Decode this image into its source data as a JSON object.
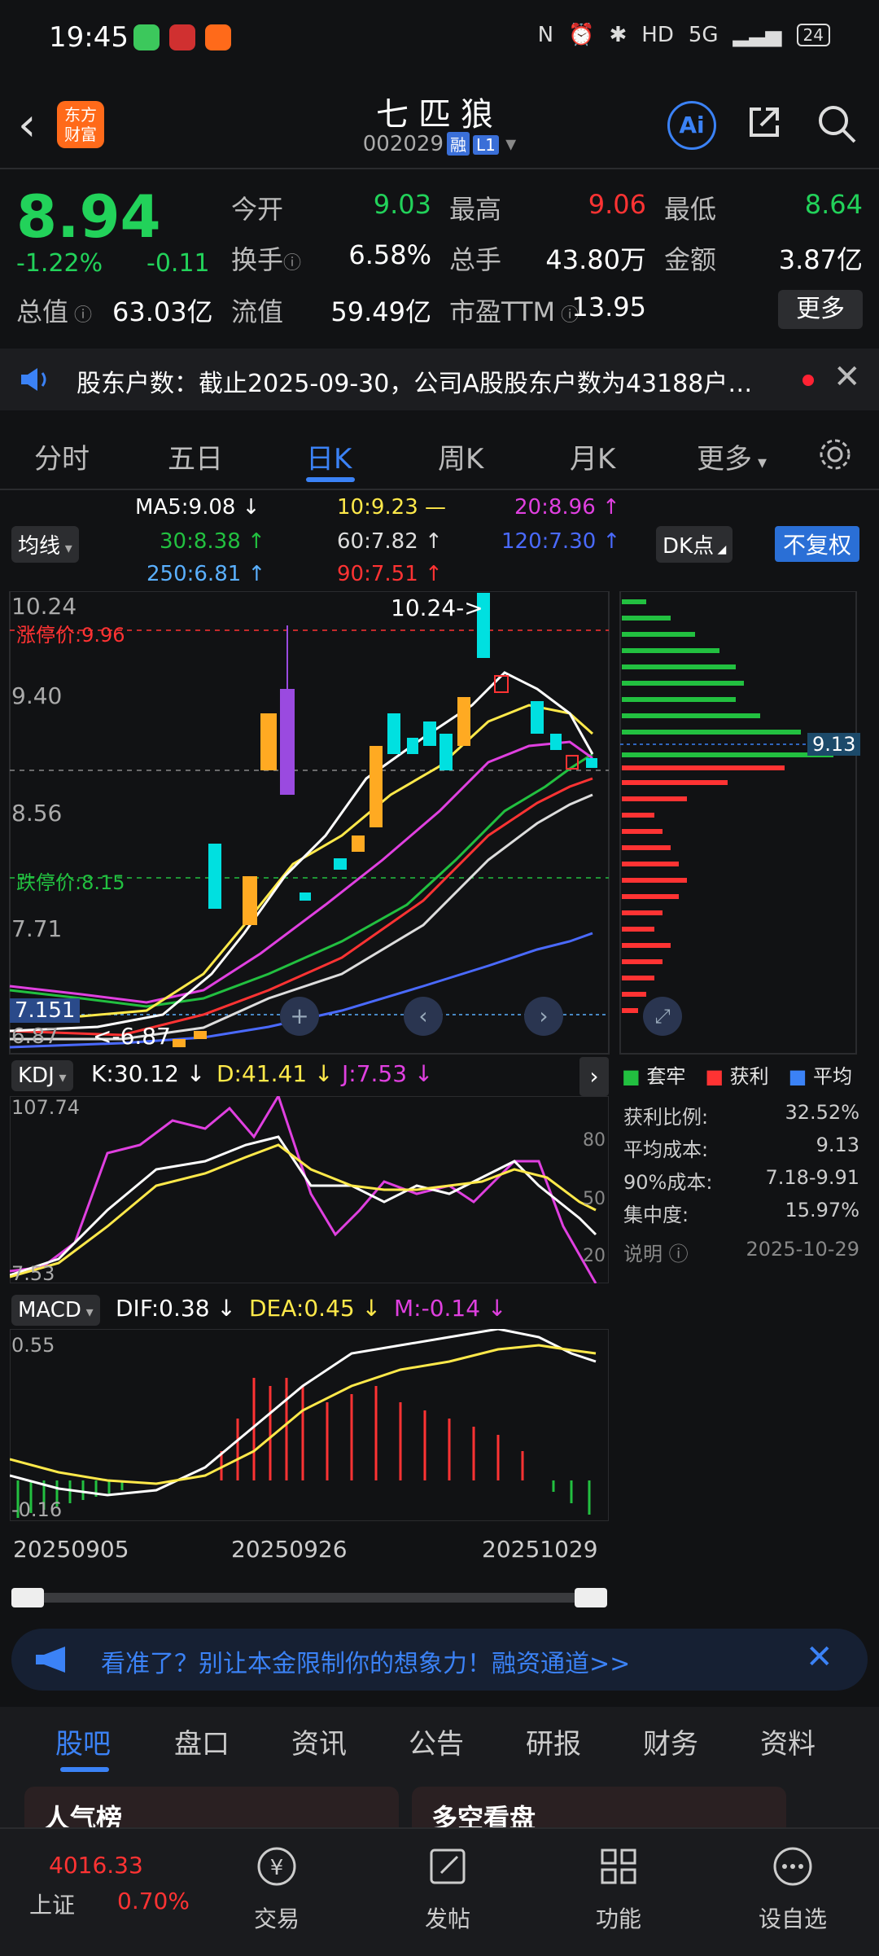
{
  "status_bar": {
    "time": "19:45",
    "network": "5G",
    "battery": "24"
  },
  "header": {
    "logo": "东方财富",
    "stock_name": "七匹狼",
    "stock_code": "002029",
    "badge_margin": "融",
    "badge_level": "L1"
  },
  "quote": {
    "price": "8.94",
    "change_pct": "-1.22%",
    "change_val": "-0.11",
    "rows": [
      [
        {
          "label": "今开",
          "value": "9.03",
          "color": "#22d25a"
        },
        {
          "label": "最高",
          "value": "9.06",
          "color": "#ff3333"
        },
        {
          "label": "最低",
          "value": "8.64",
          "color": "#22d25a"
        }
      ],
      [
        {
          "label": "换手",
          "value": "6.58%",
          "color": "#ffffff"
        },
        {
          "label": "总手",
          "value": "43.80万",
          "color": "#ffffff"
        },
        {
          "label": "金额",
          "value": "3.87亿",
          "color": "#ffffff"
        }
      ],
      [
        {
          "label": "流值",
          "value": "59.49亿",
          "color": "#ffffff"
        },
        {
          "label": "市盈TTM",
          "value": "13.95",
          "color": "#ffffff"
        }
      ]
    ],
    "market_cap_label": "总值",
    "market_cap_value": "63.03亿",
    "more": "更多"
  },
  "notice": {
    "text": "股东户数：截止2025-09-30，公司A股股东户数为43188户…"
  },
  "tabs": [
    "分时",
    "五日",
    "日K",
    "周K",
    "月K",
    "更多"
  ],
  "active_tab": "日K",
  "chart_controls": {
    "ma_selector": "均线",
    "dk_selector": "DK点",
    "adjust": "不复权"
  },
  "ma_legend": [
    {
      "text": "MA5:9.08 ↓",
      "color": "#ffffff"
    },
    {
      "text": "10:9.23 —",
      "color": "#ffe94a"
    },
    {
      "text": "20:8.96 ↑",
      "color": "#e040e0"
    },
    {
      "text": "30:8.38 ↑",
      "color": "#22c040"
    },
    {
      "text": "60:7.82 ↑",
      "color": "#dddddd"
    },
    {
      "text": "120:7.30 ↑",
      "color": "#4a6aff"
    },
    {
      "text": "250:6.81 ↑",
      "color": "#5ab0ff"
    },
    {
      "text": "90:7.51 ↑",
      "color": "#ff3333"
    }
  ],
  "kline": {
    "y_ticks": [
      "10.24",
      "9.40",
      "8.56",
      "7.71",
      "6.87"
    ],
    "limit_up": "涨停价:9.96",
    "limit_down": "跌停价:8.15",
    "high_mark": "10.24->",
    "low_mark": "<-6.87",
    "price_tag": "7.151",
    "cost_tag": "9.13"
  },
  "chip_legend": [
    {
      "text": "套牢",
      "color": "#22c040"
    },
    {
      "text": "获利",
      "color": "#ff3333"
    },
    {
      "text": "平均",
      "color": "#3b82f6"
    }
  ],
  "chip_stats": [
    {
      "label": "获利比例:",
      "value": "32.52%"
    },
    {
      "label": "平均成本:",
      "value": "9.13"
    },
    {
      "label": "90%成本:",
      "value": "7.18-9.91"
    },
    {
      "label": "集中度:",
      "value": "15.97%"
    }
  ],
  "chip_note": "说明",
  "chip_date": "2025-10-29",
  "kdj": {
    "selector": "KDJ",
    "k": "K:30.12 ↓",
    "d": "D:41.41 ↓",
    "j": "J:7.53 ↓",
    "top": "107.74",
    "bottom": "7.53",
    "levels": [
      "80",
      "50",
      "20"
    ]
  },
  "macd": {
    "selector": "MACD",
    "dif": "DIF:0.38 ↓",
    "dea": "DEA:0.45 ↓",
    "m": "M:-0.14 ↓",
    "top": "0.55",
    "bottom": "-0.16"
  },
  "dates": [
    "20250905",
    "20250926",
    "20251029"
  ],
  "ad": {
    "text": "看准了？别让本金限制你的想象力！融资通道>>"
  },
  "bottom_tabs": [
    "股吧",
    "盘口",
    "资讯",
    "公告",
    "研报",
    "财务",
    "资料"
  ],
  "cards": [
    "人气榜",
    "多空看盘"
  ],
  "nav": {
    "index_value": "4016.33",
    "index_name": "上证",
    "index_change": "0.70%",
    "items": [
      "交易",
      "发帖",
      "功能",
      "设自选"
    ]
  }
}
